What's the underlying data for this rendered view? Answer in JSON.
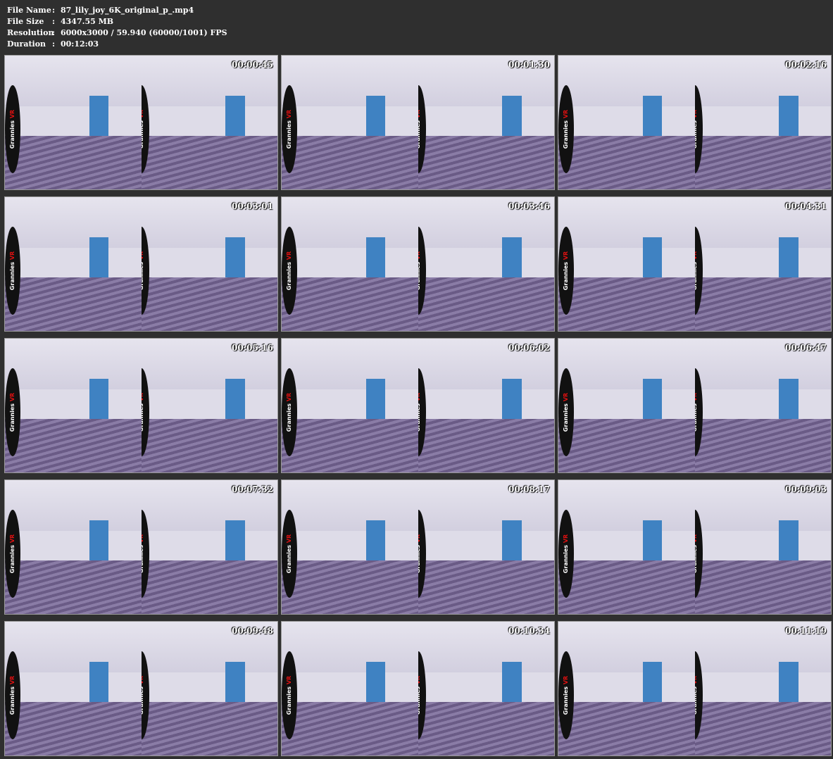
{
  "info": [
    {
      "key": "File Name",
      "value": "87_lily_joy_6K_original_p_.mp4"
    },
    {
      "key": "File Size",
      "value": "4347.55 MB"
    },
    {
      "key": "Resolution",
      "value": "6000x3000 / 59.940 (60000/1001) FPS"
    },
    {
      "key": "Duration",
      "value": "00:12:03"
    }
  ],
  "separator": ":",
  "watermark": {
    "brand": "Grannies",
    "suffix": "VR"
  },
  "thumbnails": [
    "00:00:45",
    "00:01:30",
    "00:02:16",
    "00:03:01",
    "00:03:46",
    "00:04:31",
    "00:05:16",
    "00:06:02",
    "00:06:47",
    "00:07:32",
    "00:08:17",
    "00:09:03",
    "00:09:48",
    "00:10:34",
    "00:11:19"
  ]
}
